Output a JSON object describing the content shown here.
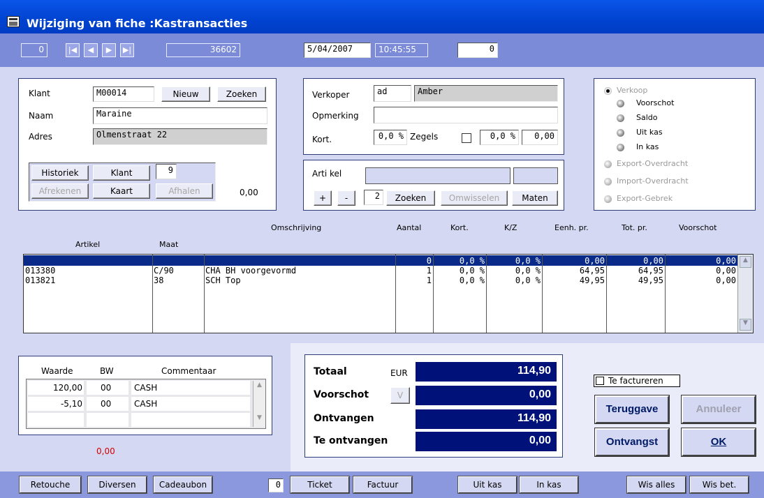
{
  "window": {
    "title": "Wijziging van fiche :Kastransacties"
  },
  "nav": {
    "counter": "0",
    "record_number": "36602",
    "date": "5/04/2007",
    "time": "10:45:55",
    "ticket_count": "0"
  },
  "customer": {
    "klant_label": "Klant",
    "klant_value": "M00014",
    "nieuw": "Nieuw",
    "zoeken": "Zoeken",
    "naam_label": "Naam",
    "naam_value": "Maraine",
    "adres_label": "Adres",
    "adres_value": "Olmenstraat 22",
    "historiek": "Historiek",
    "klant_btn": "Klant",
    "klant_count": "9",
    "afrekenen": "Afrekenen",
    "kaart": "Kaart",
    "afhalen": "Afhalen",
    "amount": "0,00"
  },
  "seller": {
    "verkoper_label": "Verkoper",
    "verkoper_code": "ad",
    "verkoper_name": "Amber",
    "opmerking_label": "Opmerking",
    "opmerking_value": "",
    "kort_label": "Kort.",
    "kort_value": "0,0 %",
    "zegels_label": "Zegels",
    "zegels_pct": "0,0 %",
    "zegels_amount": "0,00"
  },
  "article": {
    "label": "Arti kel",
    "plus": "+",
    "minus": "-",
    "qty": "2",
    "zoeken": "Zoeken",
    "omwisselen": "Omwisselen",
    "maten": "Maten"
  },
  "options": {
    "verkoop": "Verkoop",
    "voorschot": "Voorschot",
    "saldo": "Saldo",
    "uit_kas": "Uit kas",
    "in_kas": "In kas",
    "export_overdracht": "Export-Overdracht",
    "import_overdracht": "Import-Overdracht",
    "export_gebrek": "Export-Gebrek"
  },
  "table": {
    "headers": {
      "artikel": "Artikel",
      "maat": "Maat",
      "omschrijving": "Omschrijving",
      "aantal": "Aantal",
      "kort": "Kort.",
      "kz": "K/Z",
      "eenh": "Eenh. pr.",
      "tot": "Tot. pr.",
      "voorschot": "Voorschot"
    },
    "rows": [
      {
        "artikel": "",
        "maat": "",
        "omschrijving": "",
        "aantal": "0",
        "kort": "0,0 %",
        "kz": "0,0 %",
        "eenh": "0,00",
        "tot": "0,00",
        "voorschot": "0,00"
      },
      {
        "artikel": "013380",
        "maat": "C/90",
        "omschrijving": "CHA BH voorgevormd",
        "aantal": "1",
        "kort": "0,0 %",
        "kz": "0,0 %",
        "eenh": "64,95",
        "tot": "64,95",
        "voorschot": "0,00"
      },
      {
        "artikel": "013821",
        "maat": "38",
        "omschrijving": "SCH Top",
        "aantal": "1",
        "kort": "0,0 %",
        "kz": "0,0 %",
        "eenh": "49,95",
        "tot": "49,95",
        "voorschot": "0,00"
      }
    ]
  },
  "payments": {
    "headers": {
      "waarde": "Waarde",
      "bw": "BW",
      "commentaar": "Commentaar"
    },
    "rows": [
      {
        "waarde": "120,00",
        "bw": "00",
        "commentaar": "CASH"
      },
      {
        "waarde": "-5,10",
        "bw": "00",
        "commentaar": "CASH"
      }
    ],
    "rest": "0,00"
  },
  "totals": {
    "totaal_label": "Totaal",
    "currency": "EUR",
    "totaal": "114,90",
    "voorschot_label": "Voorschot",
    "v_btn": "V",
    "voorschot": "0,00",
    "ontvangen_label": "Ontvangen",
    "ontvangen": "114,90",
    "te_ontvangen_label": "Te ontvangen",
    "te_ontvangen": "0,00"
  },
  "actions": {
    "te_factureren": "Te factureren",
    "teruggave": "Teruggave",
    "annuleer": "Annuleer",
    "ontvangst": "Ontvangst",
    "ok": "OK"
  },
  "bottom": {
    "retouche": "Retouche",
    "diversen": "Diversen",
    "cadeaubon": "Cadeaubon",
    "count": "0",
    "ticket": "Ticket",
    "factuur": "Factuur",
    "uit_kas": "Uit kas",
    "in_kas": "In kas",
    "wis_alles": "Wis alles",
    "wis_bet": "Wis bet."
  },
  "colors": {
    "title_bar": "#0a55e8",
    "nav_bar": "#7b8bd8",
    "selected_row": "#0a2a8a",
    "total_box": "#00127a",
    "warning": "#d40000"
  }
}
